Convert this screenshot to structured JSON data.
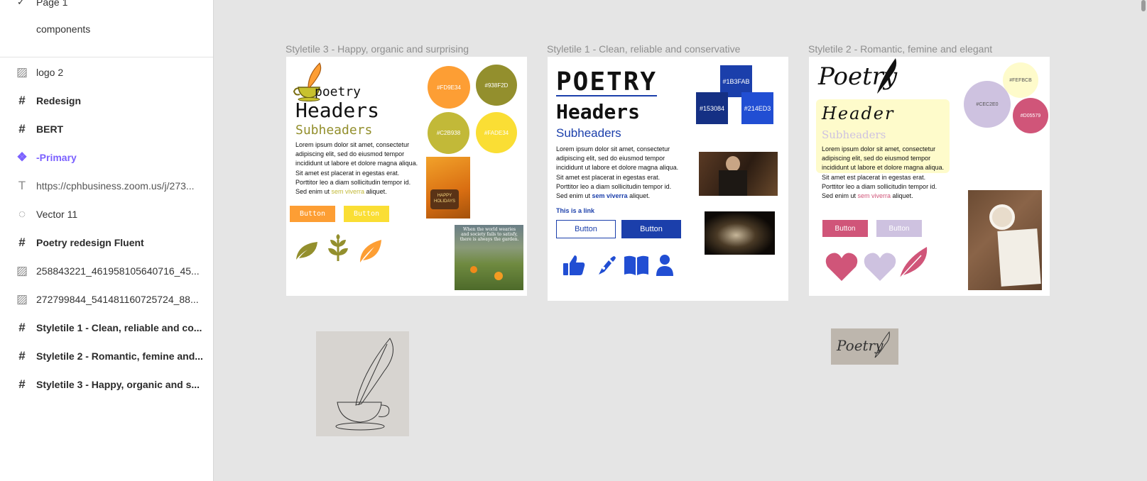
{
  "pages": {
    "items": [
      {
        "label": "Page 1",
        "checked": true
      },
      {
        "label": "components",
        "checked": false
      }
    ]
  },
  "layers": [
    {
      "label": "logo 2",
      "kind": "image",
      "icon": "image-icon"
    },
    {
      "label": "Redesign",
      "kind": "frame",
      "icon": "frame-icon"
    },
    {
      "label": "BERT",
      "kind": "frame",
      "icon": "frame-icon"
    },
    {
      "label": "-Primary",
      "kind": "component",
      "icon": "component-icon"
    },
    {
      "label": "https://cphbusiness.zoom.us/j/273...",
      "kind": "text",
      "icon": "text-icon"
    },
    {
      "label": "Vector 11",
      "kind": "vector",
      "icon": "vector-icon"
    },
    {
      "label": "Poetry redesign Fluent",
      "kind": "frame",
      "icon": "frame-icon"
    },
    {
      "label": "258843221_461958105640716_45...",
      "kind": "image",
      "icon": "image-icon"
    },
    {
      "label": "272799844_541481160725724_88...",
      "kind": "image",
      "icon": "image-icon"
    },
    {
      "label": "Styletile 1 - Clean, reliable and co...",
      "kind": "frame",
      "icon": "frame-icon"
    },
    {
      "label": "Styletile 2 - Romantic, femine and...",
      "kind": "frame",
      "icon": "frame-icon"
    },
    {
      "label": "Styletile 3 - Happy, organic and s...",
      "kind": "frame",
      "icon": "frame-icon"
    }
  ],
  "lorem_pre": "Lorem ipsum dolor sit amet, consectetur adipiscing elit, sed do eiusmod tempor incididunt ut labore et dolore magna aliqua. Sit amet est placerat in egestas erat. Porttitor leo a diam sollicitudin tempor id. Sed enim ut ",
  "lorem_link": "sem viverra",
  "lorem_post": " aliquet.",
  "tile3": {
    "title": "Styletile 3 - Happy, organic and surprising",
    "logo": "poetry",
    "headers": "Headers",
    "subheaders": "Subheaders",
    "button1": "Button",
    "button2": "Button",
    "swatches": [
      {
        "hex": "#FD9E34",
        "color": "#fd9e34"
      },
      {
        "hex": "#938F2D",
        "color": "#938f2d"
      },
      {
        "hex": "#C2B938",
        "color": "#c2b938"
      },
      {
        "hex": "#FADE34",
        "color": "#fade34"
      }
    ],
    "package_text": "HAPPY\nHOLIDAYS",
    "quote": "When the world wearies and society fails to satisfy, there is always the garden."
  },
  "tile1": {
    "title": "Styletile 1 - Clean, reliable and conservative",
    "logo": "POETRY",
    "headers": "Headers",
    "subheaders": "Subheaders",
    "link": "This is a link",
    "button1": "Button",
    "button2": "Button",
    "swatches": [
      {
        "hex": "#1B3FAB",
        "color": "#1b3fab"
      },
      {
        "hex": "#153084",
        "color": "#153084"
      },
      {
        "hex": "#214ED3",
        "color": "#214ed3"
      }
    ]
  },
  "tile2": {
    "title": "Styletile 2 - Romantic, femine and elegant",
    "logo": "Poetry",
    "header": "Header",
    "subheaders": "Subheaders",
    "button1": "Button",
    "button2": "Button",
    "swatches": [
      {
        "hex": "#FEFBCB",
        "color": "#fefbcb"
      },
      {
        "hex": "#CEC2E0",
        "color": "#cec2e0"
      },
      {
        "hex": "#D05579",
        "color": "#d05579"
      }
    ]
  },
  "sketch_logo": "Poetry"
}
